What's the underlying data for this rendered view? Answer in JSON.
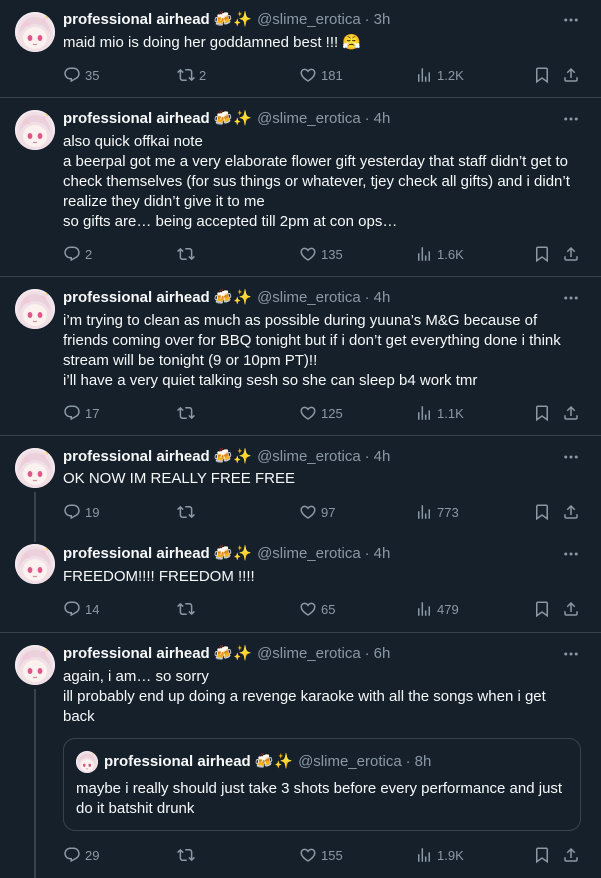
{
  "author": {
    "display_name": "professional airhead",
    "emoji": "🍻✨",
    "handle": "@slime_erotica"
  },
  "dot": "·",
  "tweets": [
    {
      "time": "3h",
      "text": "maid mio is doing her goddamned best !!! 😤",
      "replies": "35",
      "retweets": "2",
      "likes": "181",
      "views": "1.2K"
    },
    {
      "time": "4h",
      "text": "also quick offkai note\na beerpal got me a very elaborate flower gift yesterday that staff didn’t get to check themselves (for sus things or whatever, tjey check all gifts) and i didn’t realize they didn’t give it to me\nso gifts are… being accepted till 2pm at con ops…",
      "replies": "2",
      "retweets": "",
      "likes": "135",
      "views": "1.6K"
    },
    {
      "time": "4h",
      "text": "i’m trying to clean as much as possible during yuuna’s M&G because of friends coming over for BBQ tonight but if i don’t get everything done i think stream will be tonight (9 or 10pm PT)!!\ni’ll have a very quiet talking sesh so she can sleep b4 work tmr",
      "replies": "17",
      "retweets": "",
      "likes": "125",
      "views": "1.1K"
    },
    {
      "time": "4h",
      "text": "OK NOW IM REALLY FREE FREE",
      "replies": "19",
      "retweets": "",
      "likes": "97",
      "views": "773"
    },
    {
      "time": "4h",
      "text": "FREEDOM!!!! FREEDOM !!!!",
      "replies": "14",
      "retweets": "",
      "likes": "65",
      "views": "479"
    },
    {
      "time": "6h",
      "text": "again, i am… so sorry\nill probably end up doing a revenge karaoke with all the songs when i get back",
      "replies": "29",
      "retweets": "",
      "likes": "155",
      "views": "1.9K",
      "quote": {
        "time": "8h",
        "text": "maybe i really should just take 3 shots before every performance and just do it batshit drunk"
      }
    }
  ]
}
